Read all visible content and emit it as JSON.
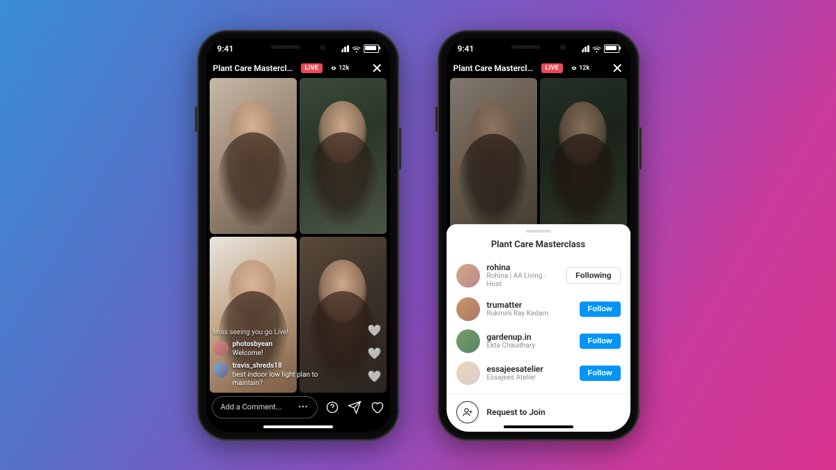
{
  "status": {
    "time": "9:41"
  },
  "live": {
    "title": "Plant Care Mastercla...",
    "badge": "LIVE",
    "viewers": "12k"
  },
  "comments": {
    "system": "Miss seeing you go Live!",
    "items": [
      {
        "user": "photosbyean",
        "text": "Welcome!"
      },
      {
        "user": "travis_shreds18",
        "text": "best indoor low light plan to maintain?"
      }
    ]
  },
  "composer": {
    "placeholder": "Add a Comment...",
    "more": "•••"
  },
  "sheet": {
    "title": "Plant Care Masterclass",
    "participants": [
      {
        "username": "rohina",
        "subtitle": "Rohina | AA Living · Host",
        "button": "Following",
        "style": "white"
      },
      {
        "username": "trumatter",
        "subtitle": "Rukmini Ray Kadam",
        "button": "Follow",
        "style": "blue"
      },
      {
        "username": "gardenup.in",
        "subtitle": "Ekta Chaudhary",
        "button": "Follow",
        "style": "blue"
      },
      {
        "username": "essajeesatelier",
        "subtitle": "Essajees Atelier",
        "button": "Follow",
        "style": "blue"
      }
    ],
    "request": "Request to Join"
  },
  "icons": {
    "close": "close-icon",
    "eye": "eye-icon",
    "question": "question-icon",
    "send": "send-icon",
    "heart": "heart-icon",
    "request": "add-person-icon"
  }
}
